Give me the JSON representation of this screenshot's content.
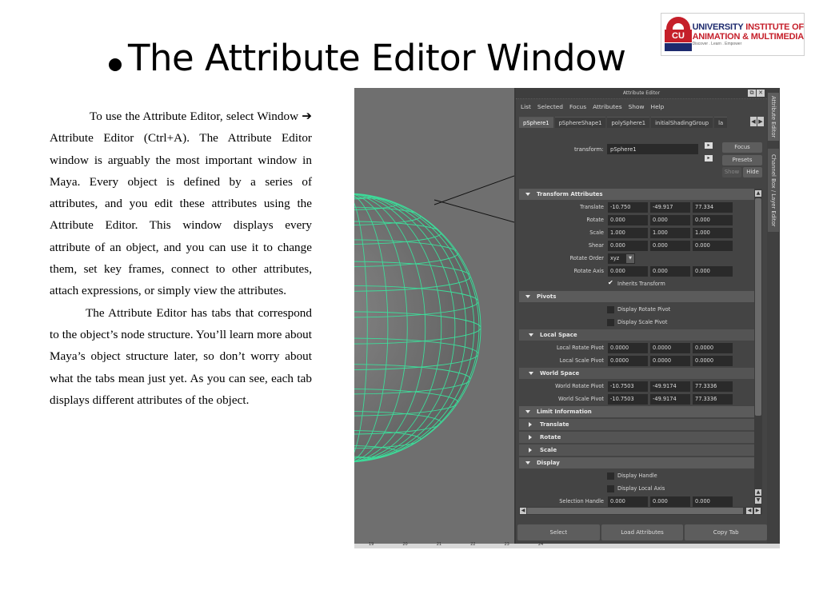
{
  "slide": {
    "title": "The Attribute Editor Window",
    "paragraph1_a": "To use the Attribute Editor, select Window ",
    "arrow": "➔",
    "paragraph1_b": " Attribute Editor (Ctrl+A). The Attribute Editor window is arguably the most important window in Maya. Every object is defined by a series of attributes, and you edit these attributes using the Attribute Editor. This window displays every attribute of an object, and you can use it to change them, set key frames, connect to other attributes, attach expressions, or simply view the attributes.",
    "paragraph2": "The Attribute Editor has tabs that correspond to the object’s node structure. You’ll learn more about Maya’s object structure later, so don’t worry about what the tabs mean just yet. As you can see, each tab displays different attributes of the object."
  },
  "logo": {
    "mark": "CU",
    "line1_a": "UNIVERSITY ",
    "line1_b": "INSTITUTE OF",
    "line2": "ANIMATION & MULTIMEDIA",
    "tagline": "Discover . Learn . Empower"
  },
  "maya": {
    "window_title": "Attribute Editor",
    "window_buttons": [
      "⧉",
      "✕"
    ],
    "menu": [
      "List",
      "Selected",
      "Focus",
      "Attributes",
      "Show",
      "Help"
    ],
    "tabs": [
      "pSphere1",
      "pSphereShape1",
      "polySphere1",
      "initialShadingGroup",
      "la"
    ],
    "tab_arrows": [
      "◀",
      "▶"
    ],
    "transform_label": "transform:",
    "transform_value": "pSphere1",
    "buttons": {
      "focus": "Focus",
      "presets": "Presets",
      "show": "Show",
      "hide": "Hide"
    },
    "sections": {
      "transform": "Transform Attributes",
      "pivots": "Pivots",
      "local_space": "Local Space",
      "world_space": "World Space",
      "limit": "Limit Information",
      "translate": "Translate",
      "rotate": "Rotate",
      "scale": "Scale",
      "display": "Display"
    },
    "transform_rows": [
      {
        "label": "Translate",
        "values": [
          "-10.750",
          "-49.917",
          "77.334"
        ]
      },
      {
        "label": "Rotate",
        "values": [
          "0.000",
          "0.000",
          "0.000"
        ]
      },
      {
        "label": "Scale",
        "values": [
          "1.000",
          "1.000",
          "1.000"
        ]
      },
      {
        "label": "Shear",
        "values": [
          "0.000",
          "0.000",
          "0.000"
        ]
      }
    ],
    "rotate_order_label": "Rotate Order",
    "rotate_order_value": "xyz",
    "rotate_axis_label": "Rotate Axis",
    "rotate_axis_values": [
      "0.000",
      "0.000",
      "0.000"
    ],
    "inherits_transform": "Inherits Transform",
    "display_rotate_pivot": "Display Rotate Pivot",
    "display_scale_pivot": "Display Scale Pivot",
    "local_rows": [
      {
        "label": "Local Rotate Pivot",
        "values": [
          "0.0000",
          "0.0000",
          "0.0000"
        ]
      },
      {
        "label": "Local Scale Pivot",
        "values": [
          "0.0000",
          "0.0000",
          "0.0000"
        ]
      }
    ],
    "world_rows": [
      {
        "label": "World Rotate Pivot",
        "values": [
          "-10.7503",
          "-49.9174",
          "77.3336"
        ]
      },
      {
        "label": "World Scale Pivot",
        "values": [
          "-10.7503",
          "-49.9174",
          "77.3336"
        ]
      }
    ],
    "display_handle": "Display Handle",
    "display_local_axis": "Display Local Axis",
    "selection_handle_label": "Selection Handle",
    "selection_handle_values": [
      "0.000",
      "0.000",
      "0.000"
    ],
    "bottom_buttons": [
      "Select",
      "Load Attributes",
      "Copy Tab"
    ],
    "side_tabs": [
      "Attribute Editor",
      "Channel Box / Layer Editor"
    ],
    "timeline_ticks": [
      "19",
      "20",
      "21",
      "22",
      "23",
      "24"
    ],
    "colors": {
      "wireframe": "#3ddc9a",
      "panel": "#444444",
      "field": "#2a2a2a"
    }
  }
}
